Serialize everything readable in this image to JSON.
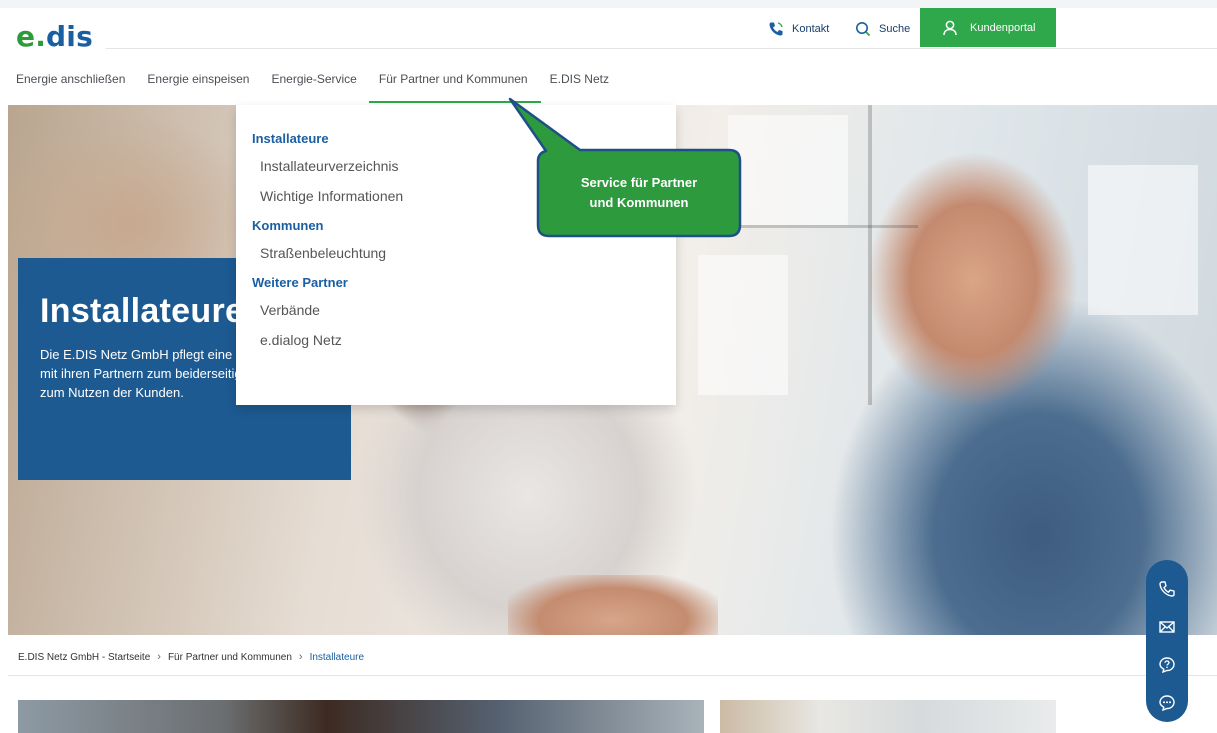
{
  "header": {
    "logo_prefix": "e.",
    "logo_name": "dis",
    "contact_label": "Kontakt",
    "search_label": "Suche",
    "portal_label": "Kundenportal"
  },
  "nav": {
    "items": [
      {
        "label": "Energie anschließen"
      },
      {
        "label": "Energie einspeisen"
      },
      {
        "label": "Energie-Service"
      },
      {
        "label": "Für Partner und Kommunen"
      },
      {
        "label": "E.DIS Netz"
      }
    ],
    "active_index": 3
  },
  "dropdown": {
    "sections": [
      {
        "heading": "Installateure",
        "items": [
          "Installateurverzeichnis",
          "Wichtige Informationen"
        ]
      },
      {
        "heading": "Kommunen",
        "items": [
          "Straßenbeleuchtung"
        ]
      },
      {
        "heading": "Weitere Partner",
        "items": [
          "Verbände",
          "e.dialog Netz"
        ]
      }
    ]
  },
  "callout": {
    "line1": "Service für Partner",
    "line2": "und Kommunen"
  },
  "hero": {
    "title": "Installateure",
    "text": "Die E.DIS Netz GmbH pflegt eine Zusammenarbeit mit ihren Partnern zum beiderseitigen Vorteil und zum Nutzen der Kunden."
  },
  "breadcrumb": {
    "items": [
      "E.DIS Netz GmbH - Startseite",
      "Für Partner und Kommunen",
      "Installateure"
    ]
  },
  "sidebar": {
    "icons": [
      "phone-icon",
      "mail-icon",
      "help-icon",
      "chat-icon"
    ]
  },
  "colors": {
    "brand_blue": "#1d5a91",
    "brand_green": "#2ea84a",
    "callout_green": "#2d9a3e"
  }
}
